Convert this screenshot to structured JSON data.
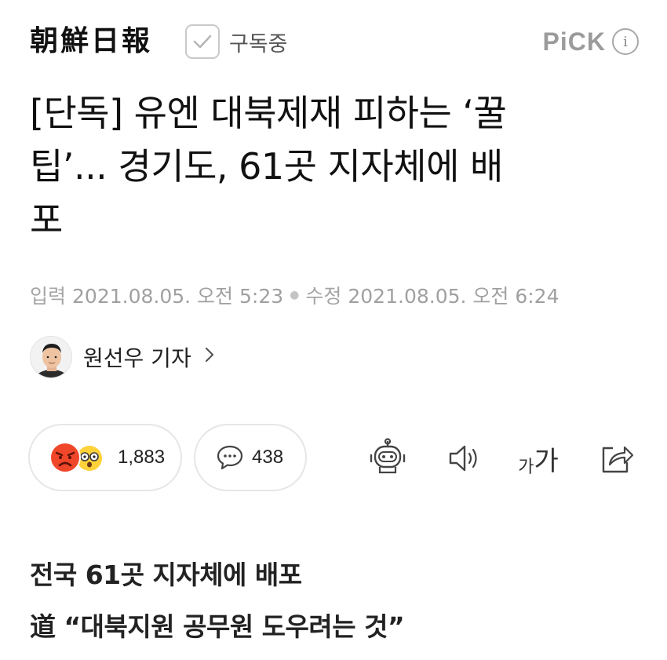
{
  "header": {
    "press_name": "朝鮮日報",
    "subscribe_label": "구독중",
    "pick_label": "PiCK",
    "info_label": "i"
  },
  "article": {
    "title_lines": [
      "[단독] 유엔 대북제재 피하는 ‘꿀",
      "팁’... 경기도, 61곳 지자체에 배",
      "포"
    ],
    "input_label": "입력",
    "input_time": "2021.08.05. 오전 5:23",
    "modified_label": "수정",
    "modified_time": "2021.08.05. 오전 6:24",
    "reporter": "원선우 기자",
    "subheads": [
      "전국 61곳 지자체에 배포",
      "道 “대북지원 공무원 도우려는 것”"
    ]
  },
  "actions": {
    "reaction_count": "1,883",
    "comment_count": "438",
    "font_small": "가",
    "font_big": "가"
  },
  "colors": {
    "text": "#111111",
    "muted": "#a0a0a0",
    "border": "#e6e6e6",
    "angry_emoji": "#f0462a",
    "wow_emoji": "#ffd23a"
  },
  "icons": [
    "checkbox-check-icon",
    "info-icon",
    "angry-face-icon",
    "surprised-face-icon",
    "comment-icon",
    "robot-summary-icon",
    "speaker-icon",
    "font-size-icon",
    "share-icon",
    "chevron-right-icon"
  ]
}
